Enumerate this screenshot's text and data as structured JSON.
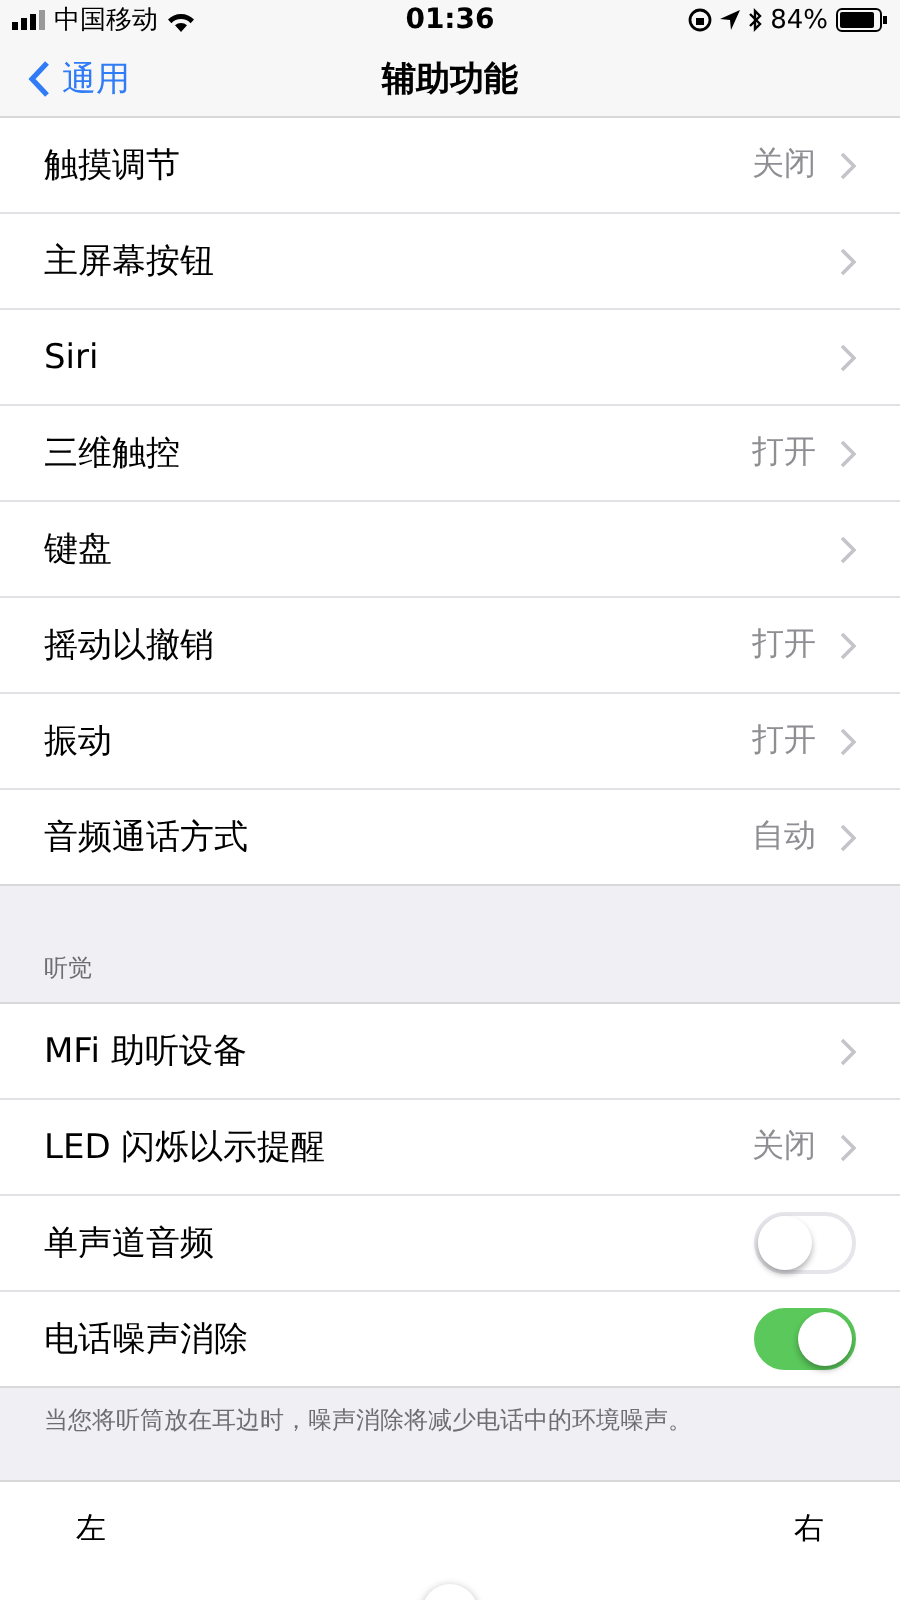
{
  "status_bar": {
    "carrier": "中国移动",
    "time": "01:36",
    "battery": "84%"
  },
  "nav": {
    "back": "通用",
    "title": "辅助功能"
  },
  "groups": [
    {
      "rows": [
        {
          "kind": "nav",
          "label": "触摸调节",
          "value": "关闭"
        },
        {
          "kind": "nav",
          "label": "主屏幕按钮"
        },
        {
          "kind": "nav",
          "label": "Siri"
        },
        {
          "kind": "nav",
          "label": "三维触控",
          "value": "打开"
        },
        {
          "kind": "nav",
          "label": "键盘"
        },
        {
          "kind": "nav",
          "label": "摇动以撤销",
          "value": "打开"
        },
        {
          "kind": "nav",
          "label": "振动",
          "value": "打开"
        },
        {
          "kind": "nav",
          "label": "音频通话方式",
          "value": "自动"
        }
      ]
    },
    {
      "header": "听觉",
      "rows": [
        {
          "kind": "nav",
          "label": "MFi 助听设备"
        },
        {
          "kind": "nav",
          "label": "LED 闪烁以示提醒",
          "value": "关闭"
        },
        {
          "kind": "toggle",
          "label": "单声道音频",
          "on": false
        },
        {
          "kind": "toggle",
          "label": "电话噪声消除",
          "on": true
        }
      ],
      "footer": "当您将听筒放在耳边时，噪声消除将减少电话中的环境噪声。"
    }
  ],
  "balance": {
    "left": "左",
    "right": "右",
    "level": 0.5
  }
}
